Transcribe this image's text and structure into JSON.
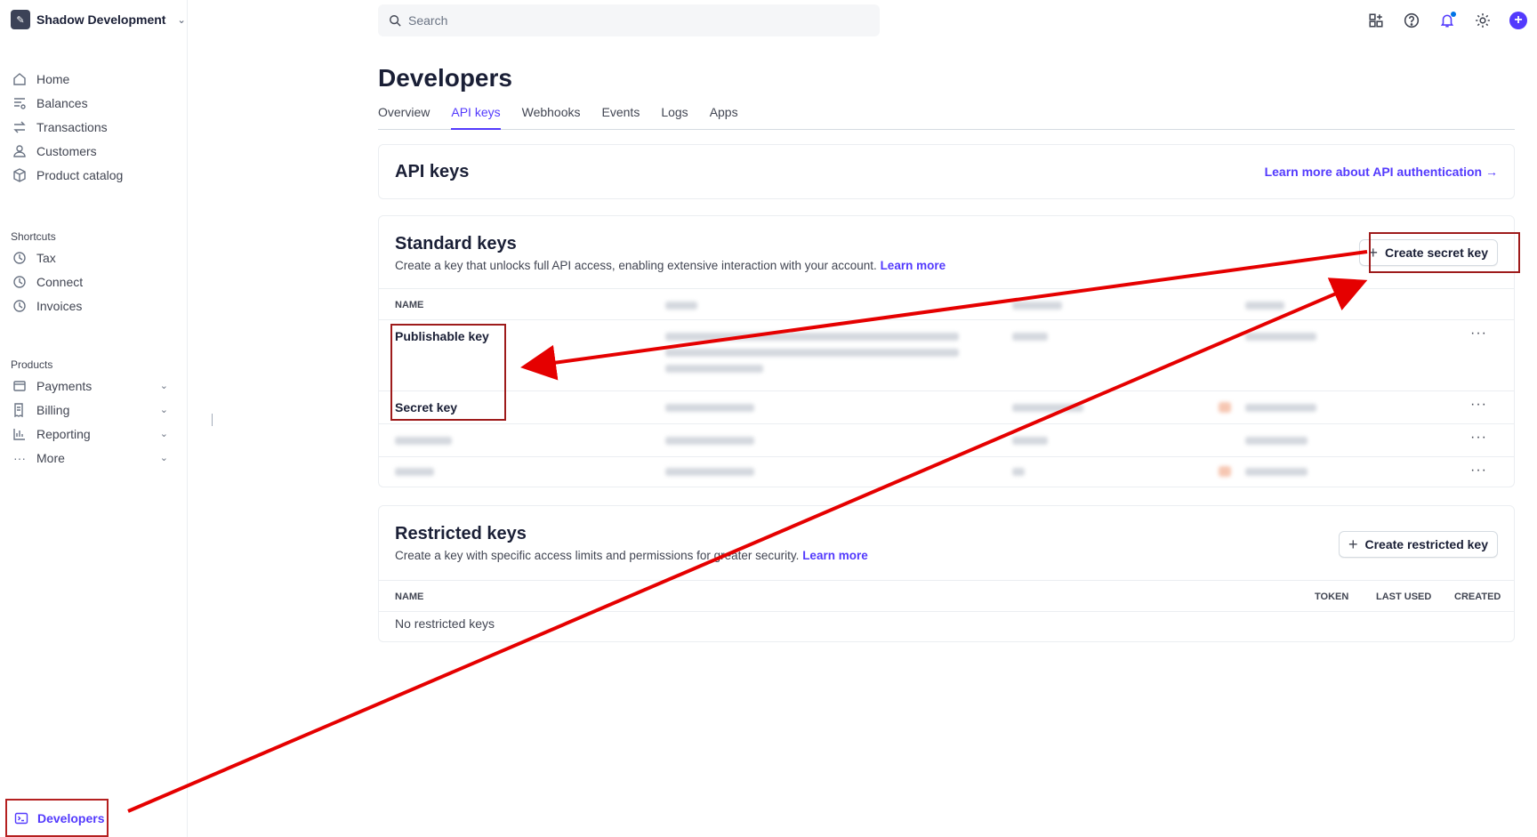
{
  "account": {
    "name": "Shadow Development"
  },
  "sidebar": {
    "main_items": [
      {
        "label": "Home",
        "icon": "home-icon"
      },
      {
        "label": "Balances",
        "icon": "balances-icon"
      },
      {
        "label": "Transactions",
        "icon": "transactions-icon"
      },
      {
        "label": "Customers",
        "icon": "customers-icon"
      },
      {
        "label": "Product catalog",
        "icon": "product-catalog-icon"
      }
    ],
    "shortcuts_title": "Shortcuts",
    "shortcuts": [
      {
        "label": "Tax",
        "icon": "clock-icon"
      },
      {
        "label": "Connect",
        "icon": "clock-icon"
      },
      {
        "label": "Invoices",
        "icon": "clock-icon"
      }
    ],
    "products_title": "Products",
    "products": [
      {
        "label": "Payments",
        "icon": "payments-icon"
      },
      {
        "label": "Billing",
        "icon": "billing-icon"
      },
      {
        "label": "Reporting",
        "icon": "reporting-icon"
      },
      {
        "label": "More",
        "icon": "more-icon"
      }
    ],
    "developers_label": "Developers"
  },
  "search": {
    "placeholder": "Search"
  },
  "page": {
    "title": "Developers",
    "tabs": [
      "Overview",
      "API keys",
      "Webhooks",
      "Events",
      "Logs",
      "Apps"
    ],
    "active_tab": "API keys"
  },
  "api_keys_card": {
    "title": "API keys",
    "learn_more": "Learn more about API authentication →"
  },
  "standard_keys": {
    "title": "Standard keys",
    "description": "Create a key that unlocks full API access, enabling extensive interaction with your account.",
    "learn_more": "Learn more",
    "create_button": "Create secret key",
    "name_header": "NAME",
    "rows": [
      {
        "name": "Publishable key"
      },
      {
        "name": "Secret key"
      },
      {
        "name": ""
      },
      {
        "name": ""
      }
    ],
    "more_actions": "···"
  },
  "restricted_keys": {
    "title": "Restricted keys",
    "description": "Create a key with specific access limits and permissions for greater security.",
    "learn_more": "Learn more",
    "create_button": "Create restricted key",
    "headers": {
      "name": "NAME",
      "token": "TOKEN",
      "last_used": "LAST USED",
      "created": "CREATED"
    },
    "empty": "No restricted keys"
  },
  "colors": {
    "accent": "#533afd",
    "annotation": "#e50000",
    "annotation_box": "#9e1b1b"
  }
}
